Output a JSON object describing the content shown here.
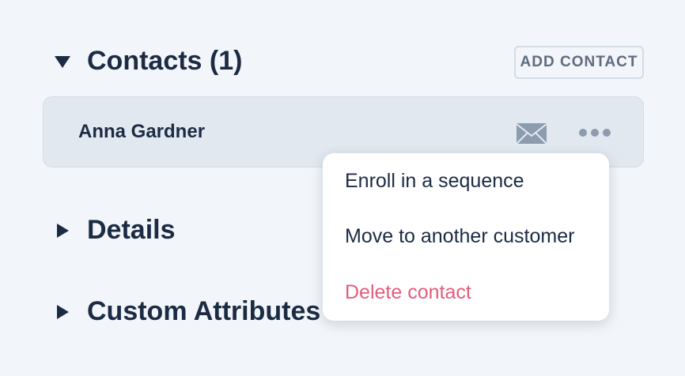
{
  "sections": {
    "contacts": {
      "title": "Contacts (1)",
      "expanded": true
    },
    "details": {
      "title": "Details",
      "expanded": false
    },
    "custom_attributes": {
      "title": "Custom Attributes",
      "expanded": false
    }
  },
  "add_contact_label": "ADD CONTACT",
  "contact": {
    "name": "Anna Gardner"
  },
  "menu": {
    "items": [
      {
        "label": "Enroll in a sequence"
      },
      {
        "label": "Move to another customer"
      },
      {
        "label": "Delete contact"
      }
    ]
  },
  "colors": {
    "background": "#f2f5f9",
    "card": "#e2e8f0",
    "text": "#1b2b44",
    "muted": "#5d6c80",
    "danger": "#e35d7a",
    "icon": "#8d9bae"
  },
  "icons": {
    "contacts_caret": "triangle-down-icon",
    "details_caret": "triangle-right-icon",
    "custom_caret": "triangle-right-icon",
    "email": "envelope-icon",
    "more": "ellipsis-icon"
  }
}
